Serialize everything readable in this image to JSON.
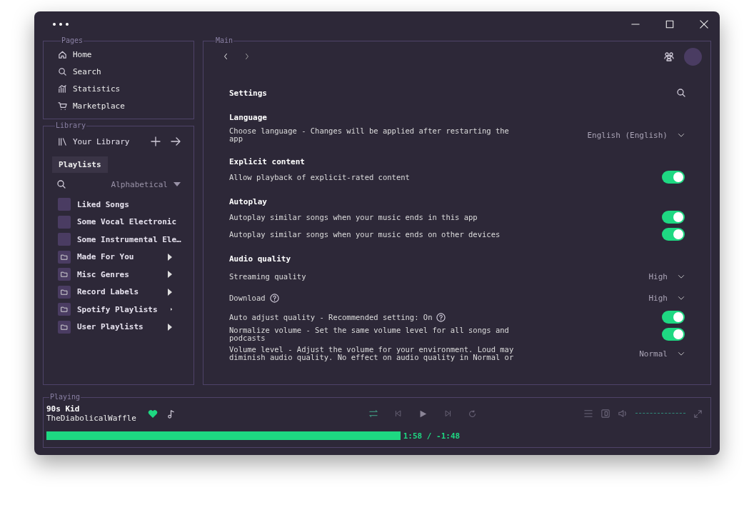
{
  "pages": {
    "legend": "Pages",
    "items": [
      {
        "label": "Home"
      },
      {
        "label": "Search"
      },
      {
        "label": "Statistics"
      },
      {
        "label": "Marketplace"
      }
    ]
  },
  "library": {
    "legend": "Library",
    "title": "Your Library",
    "chips": [
      {
        "label": "Playlists",
        "selected": true
      }
    ],
    "sort": "Alphabetical",
    "items": [
      {
        "label": "Liked Songs",
        "kind": "playlist"
      },
      {
        "label": "Some Vocal Electronic",
        "kind": "playlist"
      },
      {
        "label": "Some Instrumental Ele…",
        "kind": "playlist"
      },
      {
        "label": "Made For You",
        "kind": "folder"
      },
      {
        "label": "Misc Genres",
        "kind": "folder"
      },
      {
        "label": "Record Labels",
        "kind": "folder"
      },
      {
        "label": "Spotify Playlists",
        "kind": "folder"
      },
      {
        "label": "User Playlists",
        "kind": "folder"
      }
    ]
  },
  "main": {
    "legend": "Main",
    "title": "Settings",
    "sections": [
      {
        "title": "Language",
        "items": [
          {
            "kind": "select",
            "label": "Choose language - Changes will be applied after restarting the app",
            "value": "English (English)"
          }
        ]
      },
      {
        "title": "Explicit content",
        "items": [
          {
            "kind": "toggle",
            "label": "Allow playback of explicit-rated content",
            "on": true
          }
        ]
      },
      {
        "title": "Autoplay",
        "items": [
          {
            "kind": "toggle",
            "label": "Autoplay similar songs when your music ends in this app",
            "on": true
          },
          {
            "kind": "toggle",
            "label": "Autoplay similar songs when your music ends on other devices",
            "on": true
          }
        ]
      },
      {
        "title": "Audio quality",
        "items": [
          {
            "kind": "select",
            "label": "Streaming quality",
            "value": "High"
          },
          {
            "kind": "select",
            "label": "Download",
            "help": true,
            "value": "High"
          },
          {
            "kind": "toggle",
            "label": "Auto adjust quality - Recommended setting: On",
            "help": true,
            "on": true
          },
          {
            "kind": "toggle",
            "label": "Normalize volume - Set the same volume level for all songs and podcasts",
            "on": true
          },
          {
            "kind": "select",
            "label": "Volume level - Adjust the volume for your environment. Loud may diminish audio quality. No effect on audio quality in Normal or",
            "value": "Normal"
          }
        ]
      }
    ]
  },
  "player": {
    "legend": "Playing",
    "track": "90s Kid",
    "artist": "TheDiabolicalWaffle",
    "liked": true,
    "level": 0.54,
    "volume": {
      "level": 1
    },
    "time": "1:58 / -1:48"
  }
}
